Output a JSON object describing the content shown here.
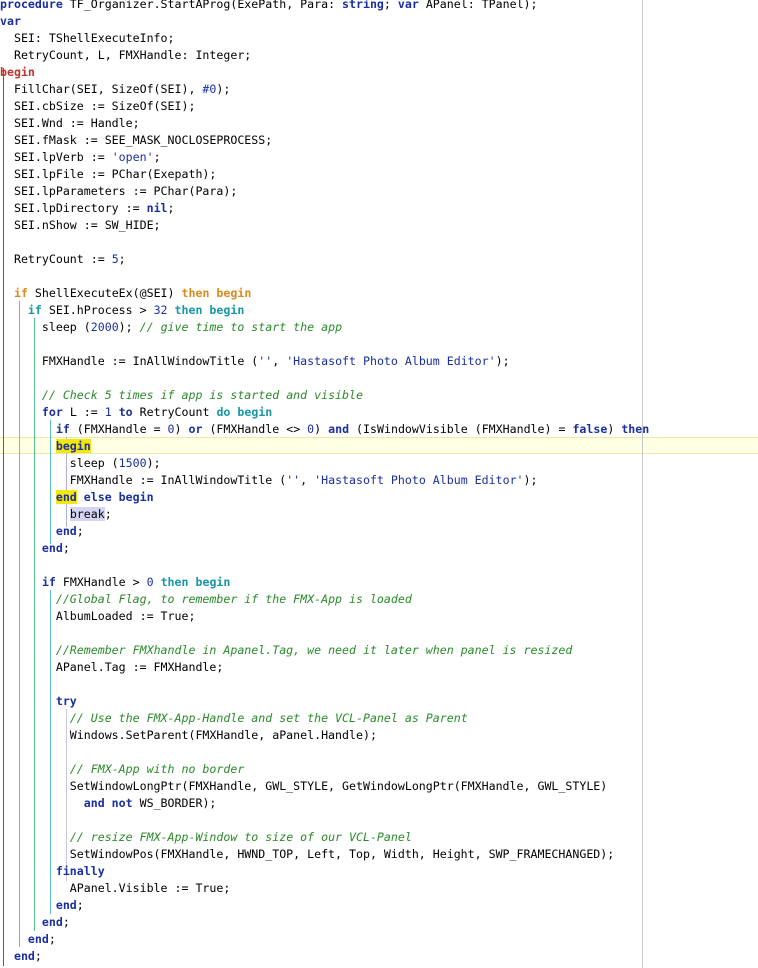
{
  "editor": {
    "lines": [
      [
        {
          "t": "procedure",
          "c": "kw"
        },
        {
          "t": " TF_Organizer.StartAProg(ExePath, Para: "
        },
        {
          "t": "string",
          "c": "kw"
        },
        {
          "t": "; "
        },
        {
          "t": "var",
          "c": "kw"
        },
        {
          "t": " APanel: TPanel);"
        }
      ],
      [
        {
          "t": "var",
          "c": "kw"
        }
      ],
      [
        {
          "t": "  SEI: TShellExecuteInfo;"
        }
      ],
      [
        {
          "t": "  RetryCount, L, FMXHandle: Integer;"
        }
      ],
      [
        {
          "t": "begin",
          "c": "kw2"
        }
      ],
      [
        {
          "t": "  FillChar(SEI, SizeOf(SEI), "
        },
        {
          "t": "#0",
          "c": "num"
        },
        {
          "t": ");"
        }
      ],
      [
        {
          "t": "  SEI.cbSize := SizeOf(SEI);"
        }
      ],
      [
        {
          "t": "  SEI.Wnd := Handle;"
        }
      ],
      [
        {
          "t": "  SEI.fMask := SEE_MASK_NOCLOSEPROCESS;"
        }
      ],
      [
        {
          "t": "  SEI.lpVerb := "
        },
        {
          "t": "'open'",
          "c": "str"
        },
        {
          "t": ";"
        }
      ],
      [
        {
          "t": "  SEI.lpFile := PChar(Exepath);"
        }
      ],
      [
        {
          "t": "  SEI.lpParameters := PChar(Para);"
        }
      ],
      [
        {
          "t": "  SEI.lpDirectory := "
        },
        {
          "t": "nil",
          "c": "kw"
        },
        {
          "t": ";"
        }
      ],
      [
        {
          "t": "  SEI.nShow := SW_HIDE;"
        }
      ],
      [],
      [
        {
          "t": "  RetryCount := "
        },
        {
          "t": "5",
          "c": "num"
        },
        {
          "t": ";"
        }
      ],
      [],
      [
        {
          "t": "  "
        },
        {
          "t": "if",
          "c": "kw3"
        },
        {
          "t": " ShellExecuteEx(@SEI) "
        },
        {
          "t": "then begin",
          "c": "kw3"
        }
      ],
      [
        {
          "t": "    "
        },
        {
          "t": "if",
          "c": "kw4"
        },
        {
          "t": " SEI.hProcess > "
        },
        {
          "t": "32",
          "c": "num"
        },
        {
          "t": " "
        },
        {
          "t": "then begin",
          "c": "kw4"
        }
      ],
      [
        {
          "t": "      sleep ("
        },
        {
          "t": "2000",
          "c": "num"
        },
        {
          "t": "); "
        },
        {
          "t": "// give time to start the app",
          "c": "com"
        }
      ],
      [],
      [
        {
          "t": "      FMXHandle := InAllWindowTitle ("
        },
        {
          "t": "''",
          "c": "str"
        },
        {
          "t": ", "
        },
        {
          "t": "'Hastasoft Photo Album Editor'",
          "c": "str"
        },
        {
          "t": ");"
        }
      ],
      [],
      [
        {
          "t": "      "
        },
        {
          "t": "// Check 5 times if app is started and visible",
          "c": "com"
        }
      ],
      [
        {
          "t": "      "
        },
        {
          "t": "for",
          "c": "kw"
        },
        {
          "t": " L := "
        },
        {
          "t": "1",
          "c": "num"
        },
        {
          "t": " "
        },
        {
          "t": "to",
          "c": "kw"
        },
        {
          "t": " RetryCount "
        },
        {
          "t": "do begin",
          "c": "kw4"
        }
      ],
      [
        {
          "t": "        "
        },
        {
          "t": "if",
          "c": "kw"
        },
        {
          "t": " (FMXHandle = "
        },
        {
          "t": "0",
          "c": "num"
        },
        {
          "t": ") "
        },
        {
          "t": "or",
          "c": "kw"
        },
        {
          "t": " (FMXHandle <> "
        },
        {
          "t": "0",
          "c": "num"
        },
        {
          "t": ") "
        },
        {
          "t": "and",
          "c": "kw"
        },
        {
          "t": " (IsWindowVisible (FMXHandle) = "
        },
        {
          "t": "false",
          "c": "kw"
        },
        {
          "t": ") "
        },
        {
          "t": "then",
          "c": "kw"
        }
      ],
      [
        {
          "t": "        "
        },
        {
          "t": "begin",
          "c": "kw mark-y"
        }
      ],
      [
        {
          "t": "          sleep ("
        },
        {
          "t": "1500",
          "c": "num"
        },
        {
          "t": ");"
        }
      ],
      [
        {
          "t": "          FMXHandle := InAllWindowTitle ("
        },
        {
          "t": "''",
          "c": "str"
        },
        {
          "t": ", "
        },
        {
          "t": "'Hastasoft Photo Album Editor'",
          "c": "str"
        },
        {
          "t": ");"
        }
      ],
      [
        {
          "t": "        "
        },
        {
          "t": "end",
          "c": "kw mark-y"
        },
        {
          "t": " "
        },
        {
          "t": "else begin",
          "c": "kw"
        }
      ],
      [
        {
          "t": "          "
        },
        {
          "t": "break",
          "c": "mark-p"
        },
        {
          "t": ";"
        }
      ],
      [
        {
          "t": "        "
        },
        {
          "t": "end",
          "c": "kw"
        },
        {
          "t": ";"
        }
      ],
      [
        {
          "t": "      "
        },
        {
          "t": "end",
          "c": "kw"
        },
        {
          "t": ";"
        }
      ],
      [],
      [
        {
          "t": "      "
        },
        {
          "t": "if",
          "c": "kw"
        },
        {
          "t": " FMXHandle > "
        },
        {
          "t": "0",
          "c": "num"
        },
        {
          "t": " "
        },
        {
          "t": "then begin",
          "c": "kw4"
        }
      ],
      [
        {
          "t": "        "
        },
        {
          "t": "//Global Flag, to remember if the FMX-App is loaded",
          "c": "com"
        }
      ],
      [
        {
          "t": "        AlbumLoaded := True;"
        }
      ],
      [],
      [
        {
          "t": "        "
        },
        {
          "t": "//Remember FMXhandle in Apanel.Tag, we need it later when panel is resized",
          "c": "com"
        }
      ],
      [
        {
          "t": "        APanel.Tag := FMXHandle;"
        }
      ],
      [],
      [
        {
          "t": "        "
        },
        {
          "t": "try",
          "c": "kw"
        }
      ],
      [
        {
          "t": "          "
        },
        {
          "t": "// Use the FMX-App-Handle and set the VCL-Panel as Parent",
          "c": "com"
        }
      ],
      [
        {
          "t": "          Windows.SetParent(FMXHandle, aPanel.Handle);"
        }
      ],
      [],
      [
        {
          "t": "          "
        },
        {
          "t": "// FMX-App with no border",
          "c": "com"
        }
      ],
      [
        {
          "t": "          SetWindowLongPtr(FMXHandle, GWL_STYLE, GetWindowLongPtr(FMXHandle, GWL_STYLE)"
        }
      ],
      [
        {
          "t": "            "
        },
        {
          "t": "and not",
          "c": "kw"
        },
        {
          "t": " WS_BORDER);"
        }
      ],
      [],
      [
        {
          "t": "          "
        },
        {
          "t": "// resize FMX-App-Window to size of our VCL-Panel",
          "c": "com"
        }
      ],
      [
        {
          "t": "          SetWindowPos(FMXHandle, HWND_TOP, Left, Top, Width, Height, SWP_FRAMECHANGED);"
        }
      ],
      [
        {
          "t": "        "
        },
        {
          "t": "finally",
          "c": "kw"
        }
      ],
      [
        {
          "t": "          APanel.Visible := True;"
        }
      ],
      [
        {
          "t": "        "
        },
        {
          "t": "end",
          "c": "kw"
        },
        {
          "t": ";"
        }
      ],
      [
        {
          "t": "      "
        },
        {
          "t": "end",
          "c": "kw"
        },
        {
          "t": ";"
        }
      ],
      [
        {
          "t": "    "
        },
        {
          "t": "end",
          "c": "kw"
        },
        {
          "t": ";"
        }
      ],
      [
        {
          "t": "  "
        },
        {
          "t": "end",
          "c": "kw"
        },
        {
          "t": ";"
        }
      ]
    ]
  }
}
